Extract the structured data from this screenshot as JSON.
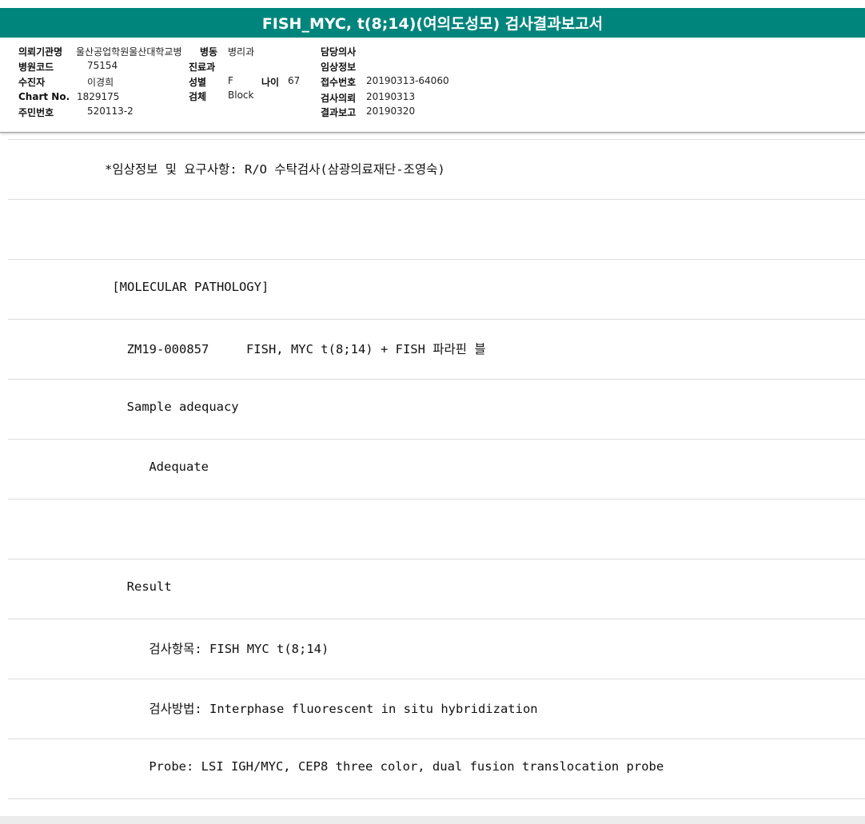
{
  "title": "FISH_MYC, t(8;14)(여의도성모) 검사결과보고서",
  "header": {
    "institution_label": "의뢰기관명",
    "institution_value": "울산공업학원울산대학교병",
    "ward_label": "병동",
    "ward_value": "병리과",
    "doctor_label": "담당의사",
    "doctor_value": "",
    "hospital_code_label": "병원코드",
    "hospital_code_value": "75154",
    "dept_label": "진료과",
    "dept_value": "",
    "clinical_info_label": "임상정보",
    "clinical_info_value": "",
    "patient_label": "수진자",
    "patient_value": "이경희",
    "sex_label": "성별",
    "sex_value": "F",
    "age_label": "나이",
    "age_value": "67",
    "receipt_label": "접수번호",
    "receipt_value": "20190313-64060",
    "chart_label": "Chart No.",
    "chart_value": "1829175",
    "specimen_label": "검체",
    "specimen_value": "Block",
    "request_label": "검사의뢰",
    "request_value": "20190313",
    "resident_label": "주민번호",
    "resident_value": "520113-2",
    "report_label": "결과보고",
    "report_value": "20190320"
  },
  "report_lines": [
    "*임상정보 및 요구사항: R/O 수탁검사(삼광의료재단-조영숙)",
    "",
    " [MOLECULAR PATHOLOGY]",
    "  ZM19-000857     FISH, MYC t(8;14) + FISH 파라핀 블",
    "  Sample adequacy",
    "    Adequate",
    "",
    "  Result",
    "    검사항목: FISH MYC t(8;14)",
    "    검사방법: Interphase fluorescent in situ hybridization",
    "    Probe: LSI IGH/MYC, CEP8 three color, dual fusion translocation probe"
  ],
  "colors": {
    "title_bar": "#00857c",
    "title_text": "#ffffff"
  }
}
